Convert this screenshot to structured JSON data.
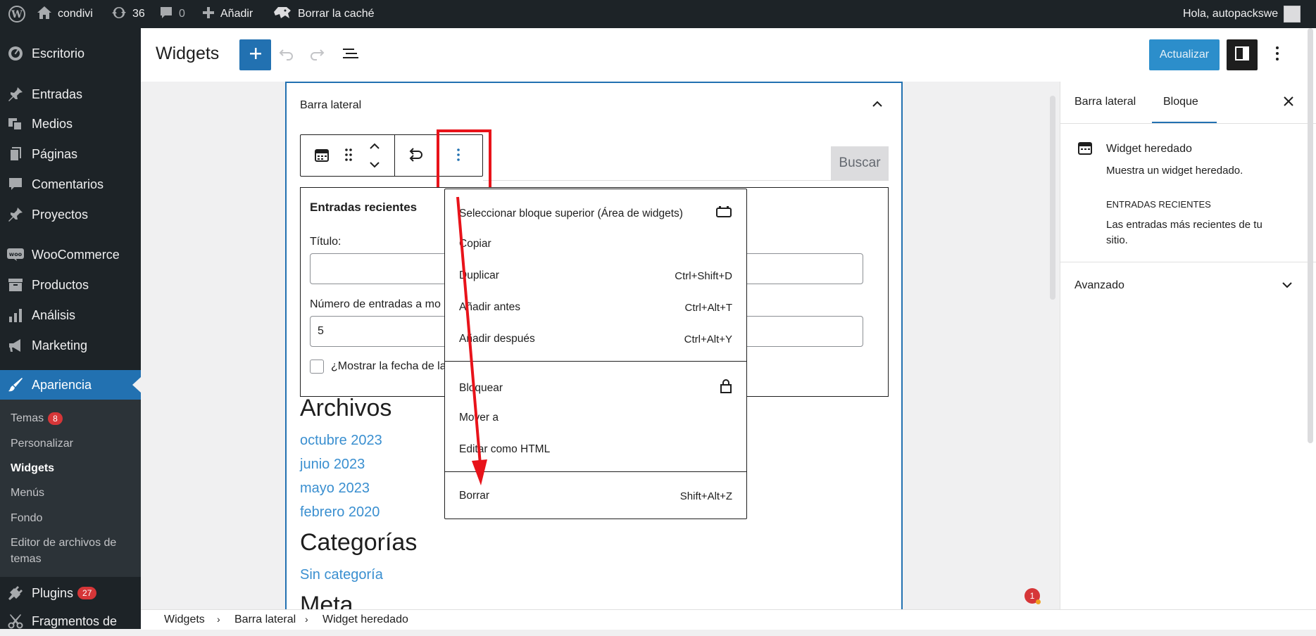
{
  "adminbar": {
    "site_name": "condivi",
    "updates_count": "36",
    "comments_count": "0",
    "add_new": "Añadir",
    "clear_cache": "Borrar la caché",
    "greeting": "Hola, autopackswe"
  },
  "sidebar": {
    "items": [
      {
        "label": "Escritorio",
        "icon": "dashboard-icon"
      },
      {
        "label": "Entradas",
        "icon": "pin-icon"
      },
      {
        "label": "Medios",
        "icon": "media-icon"
      },
      {
        "label": "Páginas",
        "icon": "page-icon"
      },
      {
        "label": "Comentarios",
        "icon": "comment-icon"
      },
      {
        "label": "Proyectos",
        "icon": "pin-icon"
      },
      {
        "label": "WooCommerce",
        "icon": "woo-icon"
      },
      {
        "label": "Productos",
        "icon": "archive-icon"
      },
      {
        "label": "Análisis",
        "icon": "chart-icon"
      },
      {
        "label": "Marketing",
        "icon": "megaphone-icon"
      },
      {
        "label": "Apariencia",
        "icon": "brush-icon"
      },
      {
        "label": "Plugins",
        "icon": "plug-icon",
        "badge": "27"
      },
      {
        "label": "Fragmentos de",
        "icon": "scissors-icon"
      }
    ],
    "submenu": [
      {
        "label": "Temas",
        "badge": "8"
      },
      {
        "label": "Personalizar"
      },
      {
        "label": "Widgets"
      },
      {
        "label": "Menús"
      },
      {
        "label": "Fondo"
      },
      {
        "label": "Editor de archivos de"
      },
      {
        "label": "temas"
      }
    ]
  },
  "header": {
    "title": "Widgets",
    "update_label": "Actualizar"
  },
  "widget_area": {
    "title": "Barra lateral",
    "search_button": "Buscar",
    "legacy_widget": {
      "title": "Entradas recientes",
      "title_label": "Título:",
      "count_label": "Número de entradas a mo",
      "count_value": "5",
      "show_date_label": "¿Mostrar la fecha de la"
    },
    "archives": {
      "heading": "Archivos",
      "links": [
        "octubre 2023",
        "junio 2023",
        "mayo 2023",
        "febrero 2020"
      ]
    },
    "categories": {
      "heading": "Categorías",
      "links": [
        "Sin categoría"
      ]
    },
    "meta": {
      "heading": "Meta"
    }
  },
  "dropdown": {
    "group1": [
      {
        "label": "Seleccionar bloque superior (Área de widgets)",
        "shortcut": ""
      },
      {
        "label": "Copiar",
        "shortcut": ""
      },
      {
        "label": "Duplicar",
        "shortcut": "Ctrl+Shift+D"
      },
      {
        "label": "Añadir antes",
        "shortcut": "Ctrl+Alt+T"
      },
      {
        "label": "Añadir después",
        "shortcut": "Ctrl+Alt+Y"
      }
    ],
    "group2": [
      {
        "label": "Bloquear",
        "shortcut": ""
      },
      {
        "label": "Mover a",
        "shortcut": ""
      },
      {
        "label": "Editar como HTML",
        "shortcut": ""
      }
    ],
    "group3": [
      {
        "label": "Borrar",
        "shortcut": "Shift+Alt+Z"
      }
    ]
  },
  "sidepanel": {
    "tabs": [
      "Barra lateral",
      "Bloque"
    ],
    "active_tab": "Bloque",
    "block_name": "Widget heredado",
    "block_desc": "Muestra un widget heredado.",
    "widget_type": "ENTRADAS RECIENTES",
    "widget_desc_1": "Las entradas más recientes de tu",
    "widget_desc_2": "sitio.",
    "advanced": "Avanzado"
  },
  "notification_count": "1",
  "breadcrumb": [
    "Widgets",
    "Barra lateral",
    "Widget heredado"
  ],
  "colors": {
    "admin_dark": "#1d2327",
    "accent": "#2271b1",
    "highlight_red": "#e8131a",
    "link": "#3a8fd0"
  }
}
